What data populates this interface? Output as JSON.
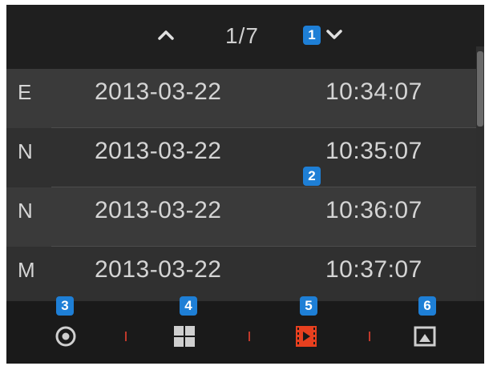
{
  "header": {
    "page_indicator": "1/7",
    "up_icon": "chevron-up-icon",
    "down_icon": "chevron-down-icon"
  },
  "callouts": {
    "c1": "1",
    "c2": "2",
    "c3": "3",
    "c4": "4",
    "c5": "5",
    "c6": "6"
  },
  "events": [
    {
      "type": "E",
      "date": "2013-03-22",
      "time": "10:34:07"
    },
    {
      "type": "N",
      "date": "2013-03-22",
      "time": "10:35:07"
    },
    {
      "type": "N",
      "date": "2013-03-22",
      "time": "10:36:07"
    },
    {
      "type": "M",
      "date": "2013-03-22",
      "time": "10:37:07"
    }
  ],
  "toolbar": {
    "items": [
      {
        "icon": "record-icon"
      },
      {
        "icon": "grid-layout-icon"
      },
      {
        "icon": "playback-icon",
        "active": true
      },
      {
        "icon": "image-capture-icon"
      }
    ]
  },
  "colors": {
    "badge": "#1e7fd6",
    "active_icon": "#e8401f",
    "divider": "#c0392b"
  }
}
